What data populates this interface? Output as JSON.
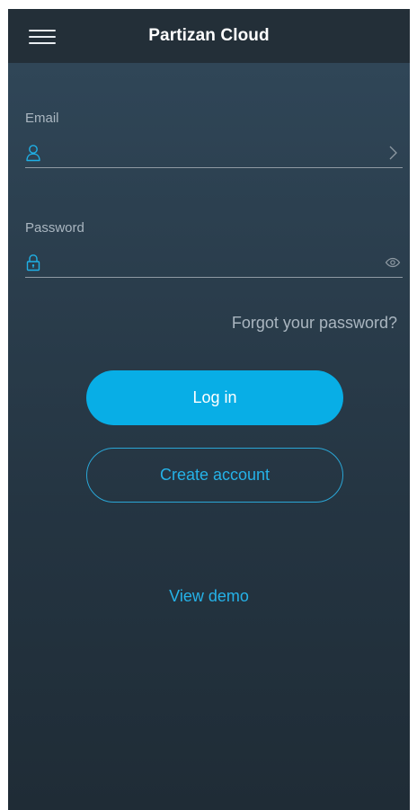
{
  "header": {
    "title": "Partizan Cloud",
    "menu_icon": "hamburger-menu-icon"
  },
  "form": {
    "email": {
      "label": "Email",
      "value": "",
      "icon": "user-icon",
      "trailing_icon": "chevron-right-icon"
    },
    "password": {
      "label": "Password",
      "value": "",
      "icon": "lock-icon",
      "trailing_icon": "eye-icon"
    },
    "forgot_label": "Forgot your password?"
  },
  "actions": {
    "login_label": "Log in",
    "create_label": "Create account",
    "demo_label": "View demo"
  },
  "colors": {
    "accent": "#08aee6",
    "link": "#25b2e8",
    "topbar": "#232f38",
    "background_top": "#31485a",
    "background_bottom": "#1f2c36"
  }
}
